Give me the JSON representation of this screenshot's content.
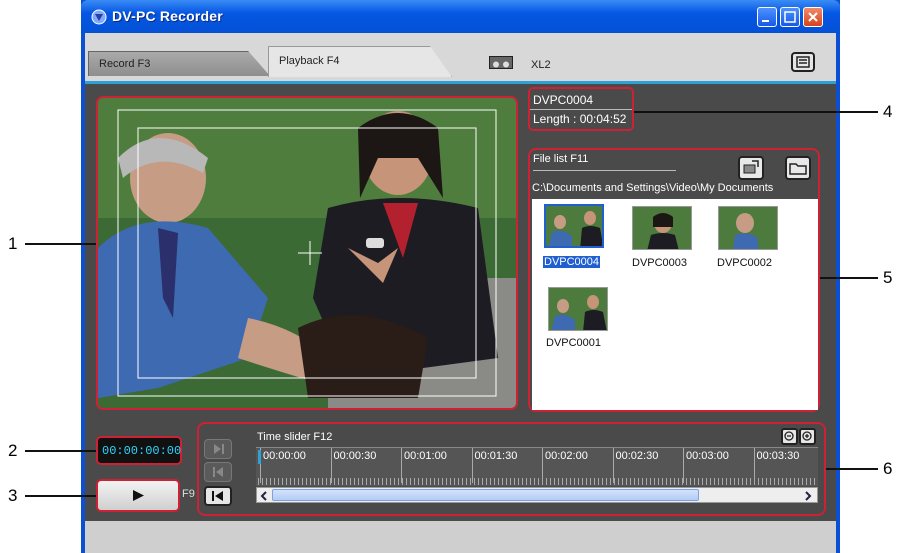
{
  "window": {
    "title": "DV-PC Recorder"
  },
  "tabs": [
    {
      "label": "Record F3"
    },
    {
      "label": "Playback F4"
    }
  ],
  "device": {
    "label": "XL2",
    "icon": "tape-icon"
  },
  "info": {
    "name": "DVPC0004",
    "length": "Length : 00:04:52"
  },
  "file_list": {
    "label": "File list F11",
    "path": "C:\\Documents and Settings\\Video\\My Documents",
    "items": [
      {
        "name": "DVPC0004",
        "selected": true
      },
      {
        "name": "DVPC0003",
        "selected": false
      },
      {
        "name": "DVPC0002",
        "selected": false
      },
      {
        "name": "DVPC0001",
        "selected": false
      }
    ]
  },
  "timecode": "00:00:00:00",
  "play": {
    "shortcut": "F9",
    "icon": "play-icon"
  },
  "time_slider": {
    "label": "Time slider F12",
    "ticks": [
      "00:00:00",
      "00:00:30",
      "00:01:00",
      "00:01:30",
      "00:02:00",
      "00:02:30",
      "00:03:00",
      "00:03:30"
    ]
  },
  "callouts": [
    "1",
    "2",
    "3",
    "4",
    "5",
    "6"
  ],
  "colors": {
    "highlight": "#cc2233",
    "accent": "#2fa2d5",
    "titlebar": "#0556e3"
  }
}
